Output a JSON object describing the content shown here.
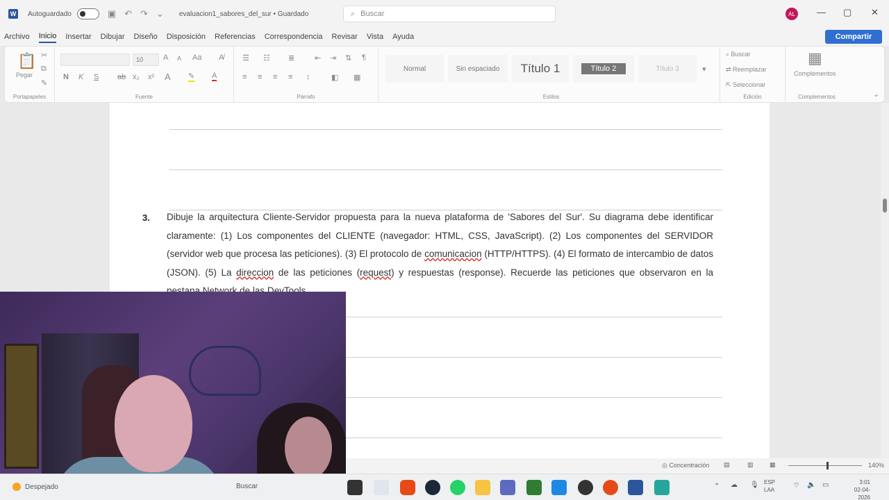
{
  "titlebar": {
    "autosave_label": "Autoguardado",
    "doc_name": "evaluacion1_sabores_del_sur • Guardado",
    "search_placeholder": "Buscar",
    "avatar_initials": "AL"
  },
  "menu": {
    "tabs": [
      "Archivo",
      "Inicio",
      "Insertar",
      "Dibujar",
      "Diseño",
      "Disposición",
      "Referencias",
      "Correspondencia",
      "Revisar",
      "Vista",
      "Ayuda"
    ],
    "active_tab": "Inicio",
    "share_label": "Compartir"
  },
  "ribbon": {
    "paste_label": "Pegar",
    "font_size": "10",
    "styles": [
      "Normal",
      "Sin espaciado",
      "Título 1",
      "Título 2",
      "Título 3"
    ],
    "editing": [
      "Buscar",
      "Reemplazar",
      "Seleccionar"
    ],
    "addins_label": "Complementos",
    "group_labels": [
      "Portapapeles",
      "Fuente",
      "Párrafo",
      "Estilos",
      "Edición",
      "Complementos"
    ]
  },
  "document": {
    "question_number": "3.",
    "question_text_parts": [
      "Dibuje la arquitectura Cliente-Servidor propuesta para la nueva plataforma de 'Sabores del Sur'. Su diagrama debe identificar claramente: (1) Los componentes del CLIENTE (navegador: HTML, CSS, JavaScript). (2) Los componentes del SERVIDOR (servidor web que procesa las peticiones). (3) El protocolo de ",
      "comunicacion",
      " (HTTP/HTTPS). (4) El formato de intercambio de datos (JSON). (5) La ",
      "direccion",
      " de las peticiones (",
      "request",
      ") y respuestas (response). Recuerde las peticiones que observaron en la ",
      "pestana",
      " Network de las ",
      "DevTools",
      "."
    ]
  },
  "statusbar": {
    "focus_label": "Concentración",
    "zoom": "140%"
  },
  "taskbar": {
    "weather_label": "Despejado",
    "search_placeholder": "Buscar",
    "lang_line1": "ESP",
    "lang_line2": "LAA",
    "time": "3:01",
    "date": "02-04-2026"
  },
  "colors": {
    "word_blue": "#2b579a",
    "share_blue": "#2f6fd1",
    "avatar_magenta": "#c2185b",
    "spell_red": "#d32f2f"
  }
}
